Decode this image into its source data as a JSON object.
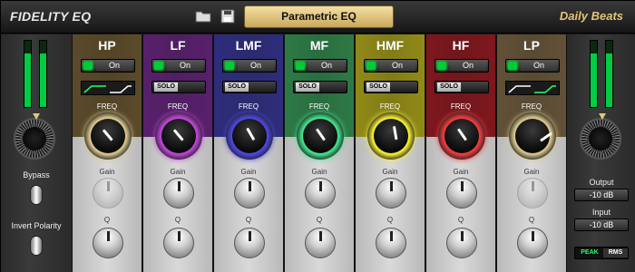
{
  "app": {
    "title": "FIDELITY EQ",
    "preset_name": "Parametric EQ",
    "preset_bank": "Daily Beats"
  },
  "colors": {
    "hp": "#5b4a2a",
    "lf": "#58206c",
    "lmf": "#2e2d7c",
    "mf": "#2d7a45",
    "hmf": "#918a18",
    "hf": "#7e171d",
    "lp": "#625137",
    "gold": "#e4c67a"
  },
  "bands": [
    {
      "name": "HP",
      "on": "On",
      "control": "shape",
      "freq": "FREQ",
      "gain": "Gain",
      "q": "Q",
      "knob_color": "#d8c48a",
      "gain_disabled": true
    },
    {
      "name": "LF",
      "on": "On",
      "control": "solo",
      "solo": "SOLO",
      "freq": "FREQ",
      "gain": "Gain",
      "q": "Q",
      "knob_color": "#c043d8",
      "gain_disabled": false
    },
    {
      "name": "LMF",
      "on": "On",
      "control": "solo",
      "solo": "SOLO",
      "freq": "FREQ",
      "gain": "Gain",
      "q": "Q",
      "knob_color": "#4b47e0",
      "gain_disabled": false
    },
    {
      "name": "MF",
      "on": "On",
      "control": "solo",
      "solo": "SOLO",
      "freq": "FREQ",
      "gain": "Gain",
      "q": "Q",
      "knob_color": "#3fe28a",
      "gain_disabled": false
    },
    {
      "name": "HMF",
      "on": "On",
      "control": "solo",
      "solo": "SOLO",
      "freq": "FREQ",
      "gain": "Gain",
      "q": "Q",
      "knob_color": "#f4ec2e",
      "gain_disabled": false
    },
    {
      "name": "HF",
      "on": "On",
      "control": "solo",
      "solo": "SOLO",
      "freq": "FREQ",
      "gain": "Gain",
      "q": "Q",
      "knob_color": "#ef3b3e",
      "gain_disabled": false
    },
    {
      "name": "LP",
      "on": "On",
      "control": "shape",
      "freq": "FREQ",
      "gain": "Gain",
      "q": "Q",
      "knob_color": "#d8c48a",
      "gain_disabled": true
    }
  ],
  "left": {
    "bypass": "Bypass",
    "invert": "Invert Polarity"
  },
  "right": {
    "output_label": "Output",
    "output_value": "-10 dB",
    "input_label": "Input",
    "input_value": "-10 dB",
    "peak": "PEAK",
    "rms": "RMS"
  }
}
